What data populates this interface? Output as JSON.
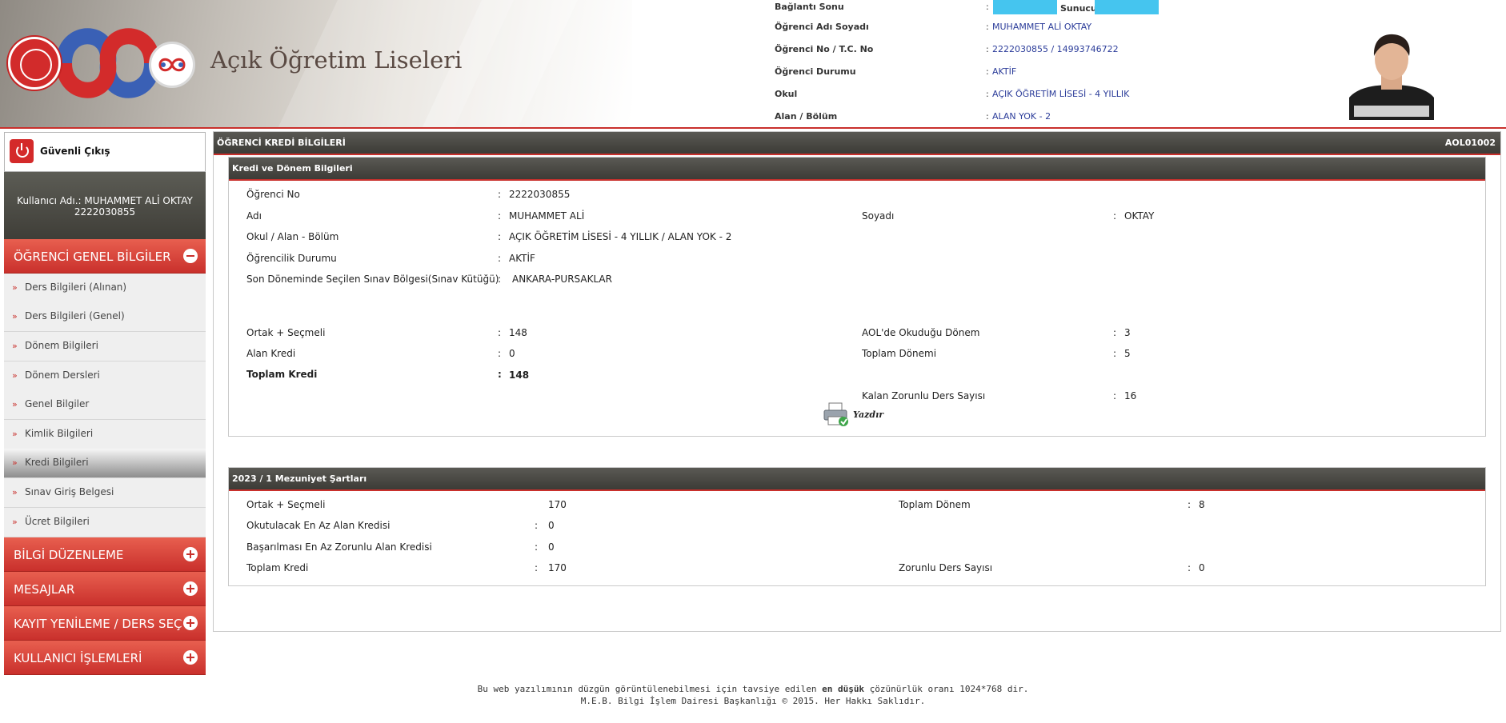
{
  "header": {
    "site_title": "Açık Öğretim Liseleri",
    "connection_label": "Bağlantı Sonu",
    "server_label": "Sunucu :",
    "student_rows": [
      {
        "label": "Öğrenci Adı Soyadı",
        "value": "MUHAMMET ALİ OKTAY"
      },
      {
        "label": "Öğrenci No / T.C. No",
        "value": "2222030855 / 14993746722"
      },
      {
        "label": "Öğrenci Durumu",
        "value": "AKTİF"
      },
      {
        "label": "Okul",
        "value": "AÇIK ÖĞRETİM LİSESİ - 4 YILLIK"
      },
      {
        "label": "Alan / Bölüm",
        "value": "ALAN YOK - 2"
      }
    ],
    "colon": ":"
  },
  "sidebar": {
    "logout_label": "Güvenli Çıkış",
    "user_line1": "Kullanıcı Adı.: MUHAMMET ALİ OKTAY",
    "user_line2": "2222030855",
    "categories": {
      "ogrenci": "ÖĞRENCİ GENEL BİLGİLER",
      "bilgi": "BİLGİ DÜZENLEME",
      "mesajlar": "MESAJLAR",
      "kayit": "KAYIT YENİLEME / DERS SEÇME",
      "kullanici": "KULLANICI İŞLEMLERİ"
    },
    "items": [
      "Ders Bilgileri (Alınan)",
      "Ders Bilgileri (Genel)",
      "Dönem Bilgileri",
      "Dönem Dersleri",
      "Genel Bilgiler",
      "Kimlik Bilgileri",
      "Kredi Bilgileri",
      "Sınav Giriş Belgesi",
      "Ücret Bilgileri"
    ],
    "active_item": "Kredi Bilgileri",
    "arrow": "»"
  },
  "main": {
    "title": "ÖĞRENCİ KREDİ BİLGİLERİ",
    "code": "AOL01002",
    "section1": {
      "title": "Kredi ve Dönem Bilgileri",
      "ogrenci_no_label": "Öğrenci No",
      "ogrenci_no": "2222030855",
      "adi_label": "Adı",
      "adi": "MUHAMMET ALİ",
      "soyadi_label": "Soyadı",
      "soyadi": "OKTAY",
      "okul_label": "Okul / Alan - Bölüm",
      "okul": "AÇIK ÖĞRETİM LİSESİ - 4 YILLIK / ALAN YOK - 2",
      "durum_label": "Öğrencilik Durumu",
      "durum": "AKTİF",
      "bolge_label": "Son Döneminde Seçilen Sınav Bölgesi(Sınav Kütüğü)",
      "bolge": "ANKARA-PURSAKLAR",
      "ortak_label": "Ortak + Seçmeli",
      "ortak": "148",
      "aol_donem_label": "AOL'de Okuduğu Dönem",
      "aol_donem": "3",
      "alan_kredi_label": "Alan Kredi",
      "alan_kredi": "0",
      "toplam_donemi_label": "Toplam Dönemi",
      "toplam_donemi": "5",
      "toplam_kredi_label": "Toplam Kredi",
      "toplam_kredi": "148",
      "kalan_label": "Kalan Zorunlu Ders Sayısı",
      "kalan": "16",
      "print_label": "Yazdır"
    },
    "section2": {
      "title": "2023 / 1 Mezuniyet Şartları",
      "ortak_label": "Ortak + Seçmeli",
      "ortak": "170",
      "toplam_donem_label": "Toplam Dönem",
      "toplam_donem": "8",
      "alan_label": "Okutulacak En Az Alan Kredisi",
      "alan": "0",
      "zorunlu_alan_label": "Başarılması En Az Zorunlu Alan Kredisi",
      "zorunlu_alan": "0",
      "toplam_kredi_label": "Toplam Kredi",
      "toplam_kredi": "170",
      "zorunlu_ders_label": "Zorunlu Ders Sayısı",
      "zorunlu_ders": "0"
    }
  },
  "footer": {
    "line1_a": "Bu web yazılımının düzgün görüntülenebilmesi için tavsiye edilen",
    "line1_b": "en düşük",
    "line1_c": "çözünürlük oranı 1024*768 dir.",
    "line2": "M.E.B. Bilgi İşlem Dairesi Başkanlığı © 2015. Her Hakkı Saklıdır."
  },
  "colors": {
    "accent_red": "#c9302c",
    "dark_bar": "#4a4944",
    "value_blue": "#2c3d9a",
    "highlight_cyan": "#45c5ef"
  }
}
